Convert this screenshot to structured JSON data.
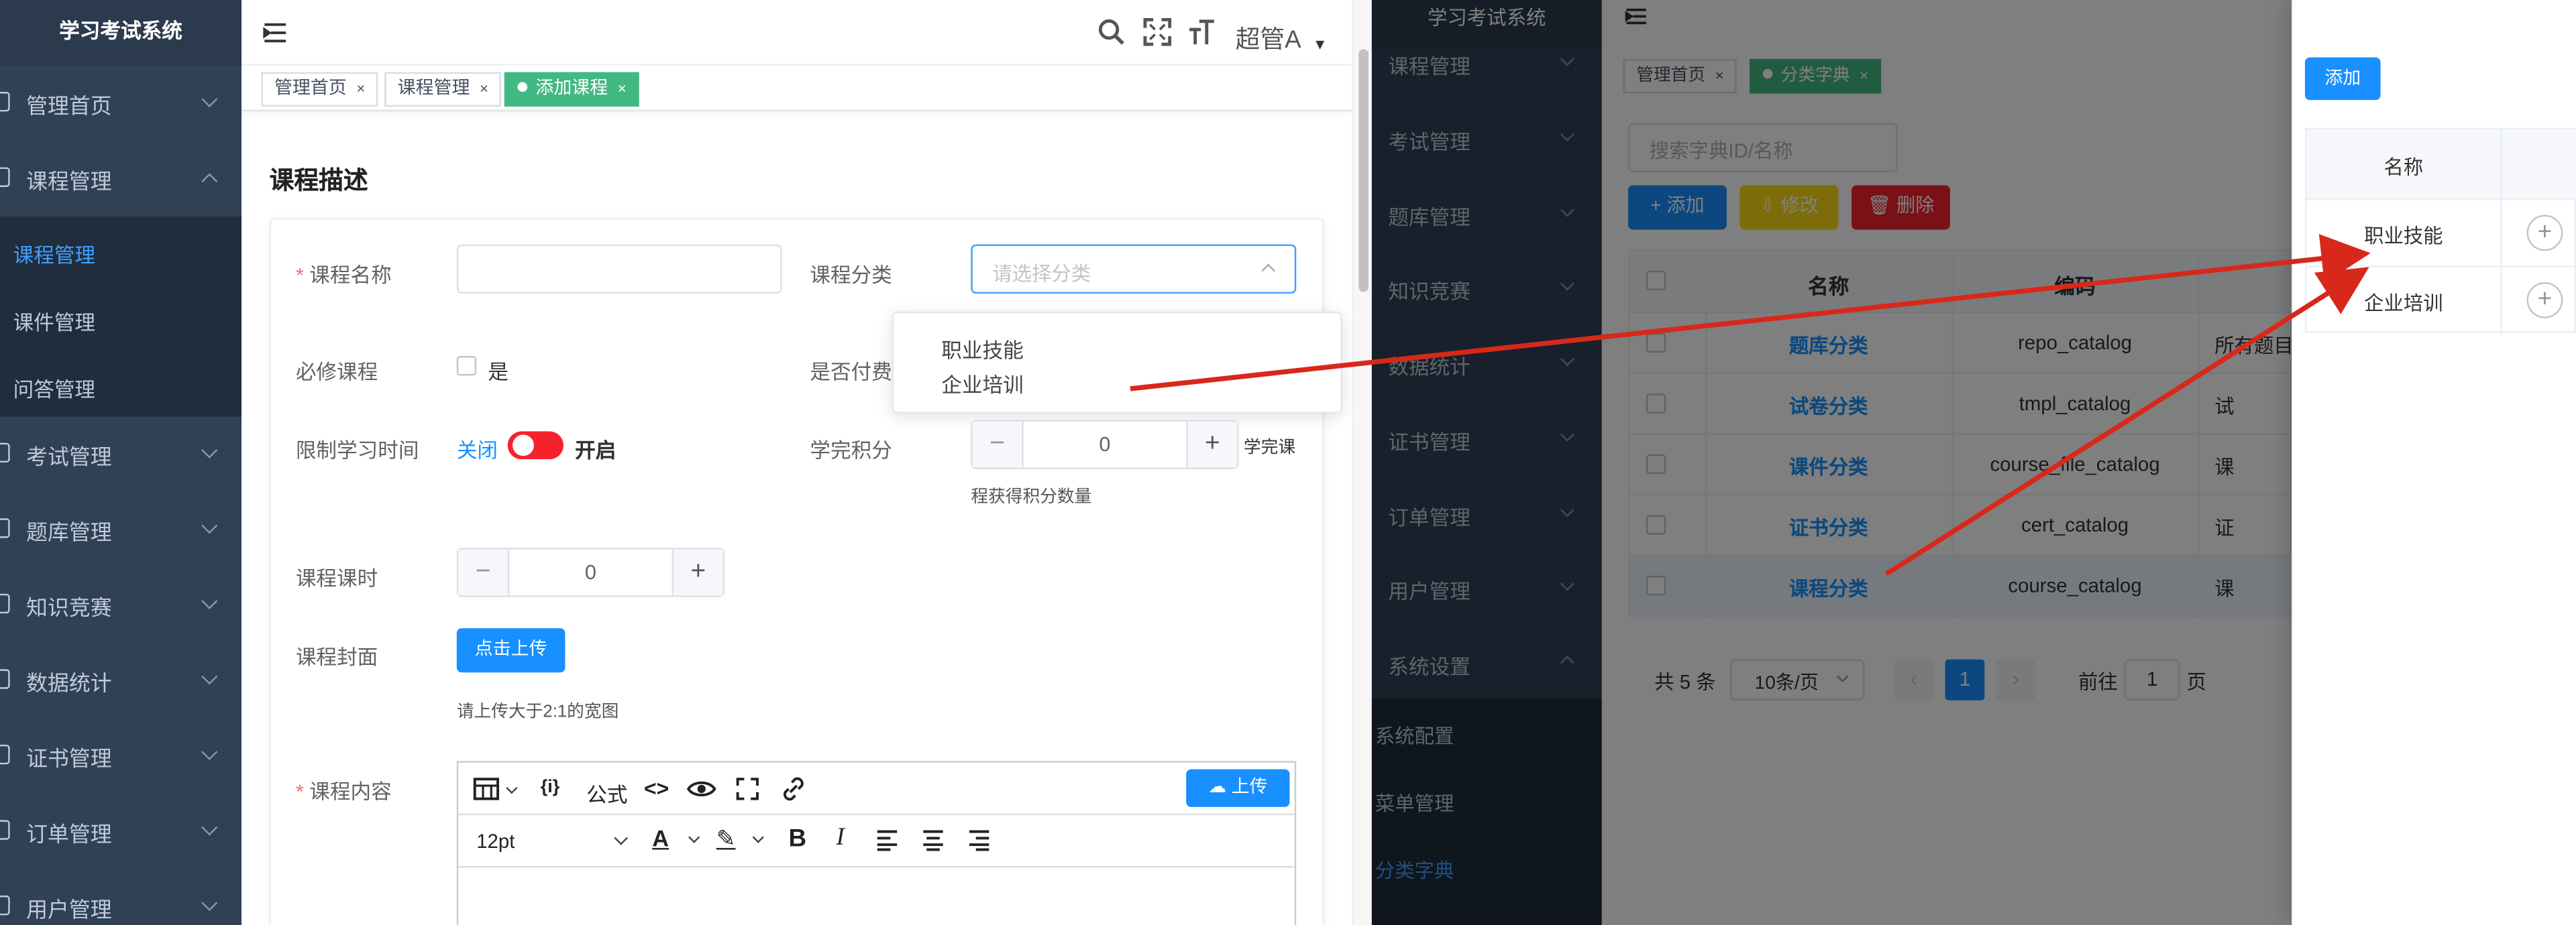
{
  "left": {
    "app_title": "学习考试系统",
    "sidebar": [
      {
        "label": "管理首页"
      },
      {
        "label": "课程管理"
      },
      {
        "label": "考试管理"
      },
      {
        "label": "题库管理"
      },
      {
        "label": "知识竞赛"
      },
      {
        "label": "数据统计"
      },
      {
        "label": "证书管理"
      },
      {
        "label": "订单管理"
      },
      {
        "label": "用户管理"
      }
    ],
    "submenu": [
      "课程管理",
      "课件管理",
      "问答管理"
    ],
    "user": "超管A",
    "tabs": [
      {
        "label": "管理首页"
      },
      {
        "label": "课程管理"
      },
      {
        "label": "添加课程"
      }
    ],
    "section_title": "课程描述",
    "form": {
      "name_label": "课程名称",
      "catalog_label": "课程分类",
      "catalog_placeholder": "请选择分类",
      "dropdown_options": [
        "职业技能",
        "企业培训"
      ],
      "required_label": "必修课程",
      "required_option": "是",
      "paid_label": "是否付费",
      "limit_label": "限制学习时间",
      "limit_off": "关闭",
      "limit_on": "开启",
      "points_label": "学完积分",
      "points_value": "0",
      "points_suffix": "学完课",
      "points_hint": "程获得积分数量",
      "hours_label": "课程课时",
      "hours_value": "0",
      "cover_label": "课程封面",
      "upload_btn": "点击上传",
      "upload_hint": "请上传大于2:1的宽图",
      "content_label": "课程内容",
      "editor_formula": "公式",
      "editor_upload": "上传",
      "editor_fontsize": "12pt"
    }
  },
  "middle": {
    "app_title": "学习考试系统",
    "sidebar": [
      "课程管理",
      "考试管理",
      "题库管理",
      "知识竞赛",
      "数据统计",
      "证书管理",
      "订单管理",
      "用户管理",
      "系统设置"
    ],
    "submenu": [
      "系统配置",
      "菜单管理",
      "分类字典"
    ],
    "tabs": [
      "管理首页",
      "分类字典"
    ],
    "search_placeholder": "搜索字典ID/名称",
    "btn_add": "添加",
    "btn_edit": "修改",
    "btn_delete": "删除",
    "table": {
      "headers": [
        "名称",
        "编码"
      ],
      "rows": [
        {
          "name": "题库分类",
          "code": "repo_catalog",
          "extra": "所有题目"
        },
        {
          "name": "试卷分类",
          "code": "tmpl_catalog",
          "extra": "试"
        },
        {
          "name": "课件分类",
          "code": "course_file_catalog",
          "extra": "课"
        },
        {
          "name": "证书分类",
          "code": "cert_catalog",
          "extra": "证"
        },
        {
          "name": "课程分类",
          "code": "course_catalog",
          "extra": "课"
        }
      ]
    },
    "pagination": {
      "total": "共 5 条",
      "page_size": "10条/页",
      "current": "1",
      "goto": "前往",
      "goto_value": "1",
      "page_suffix": "页"
    }
  },
  "right": {
    "btn_add": "添加",
    "header_name": "名称",
    "rows": [
      "职业技能",
      "企业培训"
    ]
  },
  "colors": {
    "sidebar": "#304156",
    "primary": "#1890ff",
    "tag": "#42b983",
    "arrow": "#d8281a"
  }
}
